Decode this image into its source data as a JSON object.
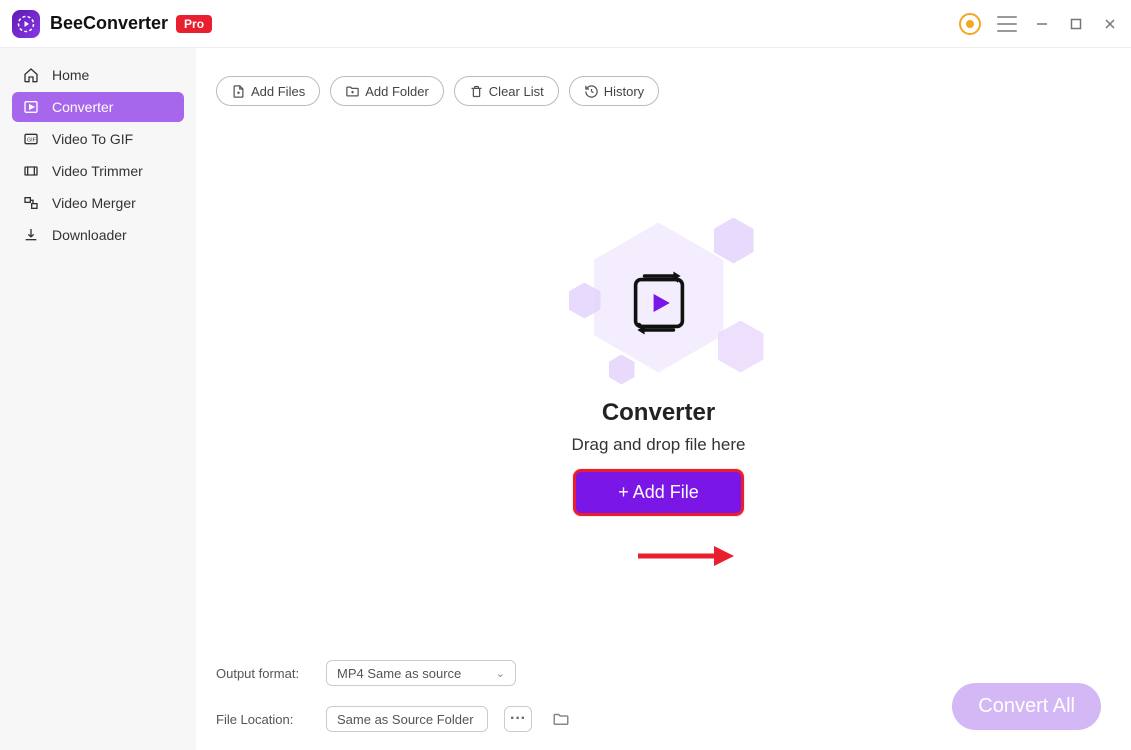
{
  "app": {
    "name": "BeeConverter",
    "badge": "Pro"
  },
  "sidebar": {
    "items": [
      {
        "label": "Home",
        "icon": "home"
      },
      {
        "label": "Converter",
        "icon": "play-square",
        "active": true
      },
      {
        "label": "Video To GIF",
        "icon": "gif"
      },
      {
        "label": "Video Trimmer",
        "icon": "trim"
      },
      {
        "label": "Video Merger",
        "icon": "merge"
      },
      {
        "label": "Downloader",
        "icon": "download"
      }
    ]
  },
  "toolbar": {
    "add_files": "Add Files",
    "add_folder": "Add Folder",
    "clear_list": "Clear List",
    "history": "History"
  },
  "center": {
    "title": "Converter",
    "subtitle": "Drag and drop file here",
    "add_file_button": "+ Add File"
  },
  "bottom": {
    "output_format_label": "Output format:",
    "output_format_value": "MP4 Same as source",
    "file_location_label": "File Location:",
    "file_location_value": "Same as Source Folder",
    "browse": "···",
    "convert_all": "Convert All"
  }
}
